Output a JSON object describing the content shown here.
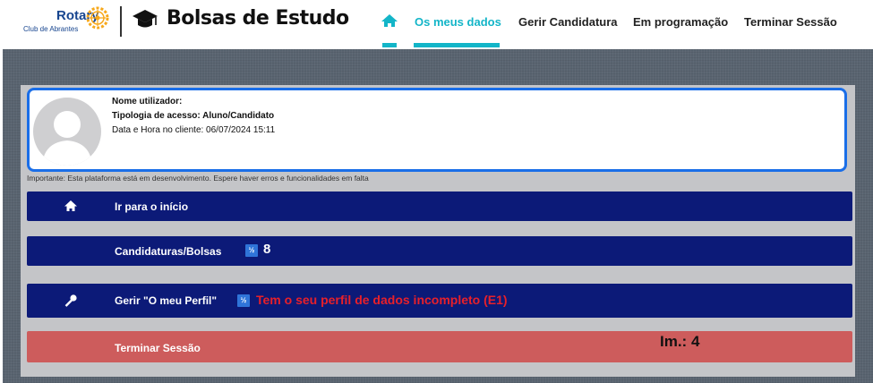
{
  "brand": {
    "rotary": "Rotary",
    "club": "Club de Abrantes",
    "title": "Bolsas de Estudo"
  },
  "nav": {
    "items": [
      {
        "label": "Os meus dados",
        "active": true
      },
      {
        "label": "Gerir Candidatura",
        "active": false
      },
      {
        "label": "Em programação",
        "active": false
      },
      {
        "label": "Terminar Sessão",
        "active": false
      }
    ]
  },
  "profile": {
    "user_label": "Nome utilizador:",
    "access_label": "Tipologia de acesso: Aluno/Candidato",
    "datetime_label": "Data e Hora no cliente: 06/07/2024 15:11"
  },
  "notice": "Importante: Esta plataforma está em desenvolvimento. Espere haver erros e funcionalidades em falta",
  "menu": {
    "home": {
      "label": "Ir para o início",
      "icon": "home-icon"
    },
    "applications": {
      "label": "Candidaturas/Bolsas",
      "chip": "½",
      "count": "8"
    },
    "profile": {
      "label": "Gerir \"O meu Perfil\"",
      "icon": "key-icon",
      "chip": "½",
      "alert": "Tem o seu perfil de dados incompleto (E1)"
    },
    "logout": {
      "label": "Terminar Sessão",
      "im": "Im.: 4"
    }
  },
  "colors": {
    "accent": "#13b5c8",
    "menu_bar": "#0c1a78",
    "logout_bar": "#cd5c5c",
    "alert": "#e8202a",
    "card_border": "#1a6ee8"
  }
}
